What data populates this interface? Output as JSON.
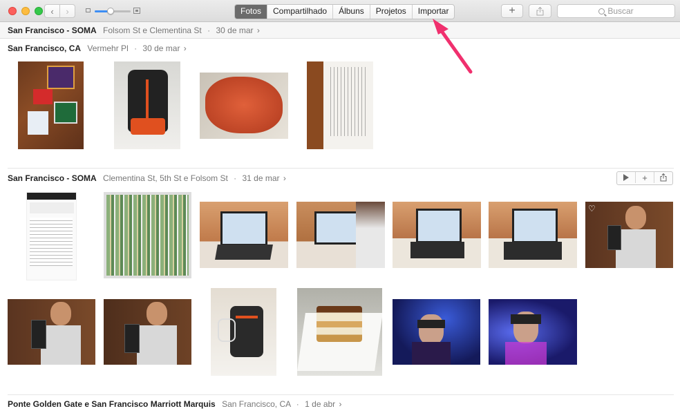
{
  "toolbar": {
    "back": "‹",
    "forward": "›",
    "tabs": [
      "Fotos",
      "Compartilhado",
      "Álbuns",
      "Projetos",
      "Importar"
    ],
    "active_tab": "Fotos",
    "add_label": "+",
    "search_placeholder": "Buscar",
    "zoom_level": 0.45
  },
  "sticky_header": {
    "location": "San Francisco - SOMA",
    "detail": "Folsom St e Clementina St",
    "separator": "·",
    "date": "30 de mar",
    "chevron": "›"
  },
  "moments": [
    {
      "location": "San Francisco, CA",
      "detail": "Vermehr Pl",
      "separator": "·",
      "date": "30 de mar",
      "chevron": "›"
    },
    {
      "location": "San Francisco - SOMA",
      "detail": "Clementina St, 5th St e Folsom St",
      "separator": "·",
      "date": "31 de mar",
      "chevron": "›"
    },
    {
      "location": "Ponte Golden Gate e San Francisco Marriott Marquis",
      "detail": "San Francisco, CA",
      "separator": "·",
      "date": "1 de abr",
      "chevron": "›"
    }
  ],
  "moment_actions": {
    "play": "▶",
    "add": "+",
    "share": "share"
  },
  "colors": {
    "accent": "#3d8ef4",
    "arrow": "#f0306e",
    "active_tab": "#6b6b6b"
  },
  "photos": [
    {
      "name": "photo-cards-on-table",
      "subject": "electronic items on wooden table"
    },
    {
      "name": "photo-black-backpack",
      "subject": "black and orange backpack"
    },
    {
      "name": "photo-orange-pouch",
      "subject": "orange pouch"
    },
    {
      "name": "photo-document",
      "subject": "printed document"
    },
    {
      "name": "photo-phone-screenshot",
      "subject": "phone screenshot"
    },
    {
      "name": "photo-battery-tray",
      "subject": "tray of batteries"
    },
    {
      "name": "photo-laptop-1",
      "subject": "laptop on desk"
    },
    {
      "name": "photo-laptop-2",
      "subject": "man using laptop"
    },
    {
      "name": "photo-laptop-3",
      "subject": "laptop"
    },
    {
      "name": "photo-laptop-4",
      "subject": "laptop"
    },
    {
      "name": "photo-man-phone-1",
      "subject": "man holding phone",
      "favorite": true
    },
    {
      "name": "photo-man-phone-2",
      "subject": "man holding phone"
    },
    {
      "name": "photo-man-phone-3",
      "subject": "man holding phone"
    },
    {
      "name": "photo-backpack-standing",
      "subject": "backpack"
    },
    {
      "name": "photo-cake",
      "subject": "slice of cake"
    },
    {
      "name": "photo-vr-blue-1",
      "subject": "person with headset"
    },
    {
      "name": "photo-vr-blue-2",
      "subject": "person with headset"
    }
  ]
}
